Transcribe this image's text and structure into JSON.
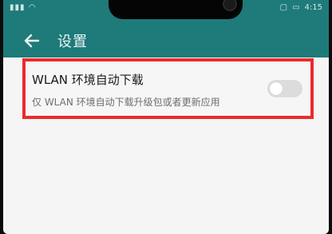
{
  "status_bar": {
    "left_text": "",
    "time": "4:15",
    "icons": [
      "signal-icon",
      "wifi-icon",
      "notification-icon",
      "battery-icon"
    ]
  },
  "app_bar": {
    "title": "设置",
    "back_icon": "back-arrow-icon"
  },
  "setting": {
    "title": "WLAN 环境自动下载",
    "subtitle": "仅 WLAN 环境自动下载升级包或者更新应用",
    "toggle_on": false
  },
  "colors": {
    "app_bar": "#1f7a7a",
    "highlight_border": "#ea2b2b",
    "toggle_off": "#dcdcdc"
  }
}
